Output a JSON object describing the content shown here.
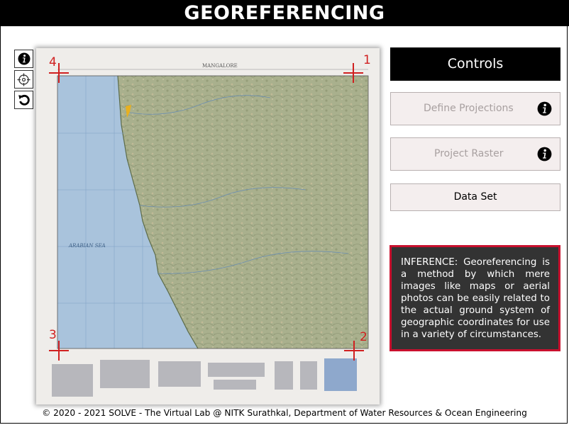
{
  "header": {
    "title": "GEOREFERENCING"
  },
  "toolbar": {
    "tools": [
      {
        "icon": "info-icon"
      },
      {
        "icon": "crosshair-icon"
      },
      {
        "icon": "reset-icon"
      }
    ]
  },
  "map": {
    "top_title": "MANGALORE",
    "sea_label": "ARABIAN SEA",
    "markers": [
      {
        "number": "1"
      },
      {
        "number": "2"
      },
      {
        "number": "3"
      },
      {
        "number": "4"
      }
    ],
    "colors": {
      "sea": "#a9c3dc",
      "land": "#a9b58f",
      "marker": "#d02020"
    }
  },
  "controls": {
    "title": "Controls",
    "define_projections_label": "Define Projections",
    "project_raster_label": "Project Raster",
    "data_set_label": "Data Set"
  },
  "inference": {
    "text": "INFERENCE: Georeferencing is a method by which mere images like maps or aerial photos can be easily related to the actual ground system of geographic coordinates for use in a variety of circumstances."
  },
  "footer": {
    "text": "© 2020 - 2021 SOLVE - The Virtual Lab @ NITK Surathkal, Department of Water Resources & Ocean Engineering"
  }
}
